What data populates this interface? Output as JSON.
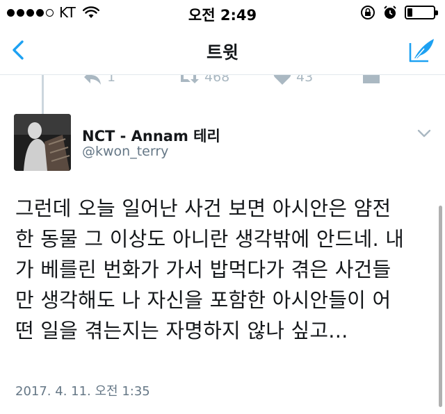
{
  "status_bar": {
    "carrier": "KT",
    "time": "오전 2:49",
    "battery_level": 0.2
  },
  "nav": {
    "title": "트윗",
    "back_icon": "chevron-left-icon",
    "compose_icon": "compose-quill-icon",
    "accent_color": "#1da1f2"
  },
  "prev_tweet_actions": {
    "reply_count": "1",
    "retweet_count": "468",
    "like_count": "43"
  },
  "tweet": {
    "display_name": "NCT - Annam 테리",
    "username": "@kwon_terry",
    "text_lines": [
      "그런데 오늘 일어난 사건 보면 아시안은 얌전",
      "한 동물 그 이상도 아니란 생각밖에 안드네. 내",
      "가 베를린 번화가 가서 밥먹다가 겪은 사건들",
      "만 생각해도 나 자신을 포함한 아시안들이 어",
      "떤 일을 겪는지는 자명하지 않나 싶고..."
    ],
    "timestamp": "2017. 4. 11. 오전 1:35"
  }
}
